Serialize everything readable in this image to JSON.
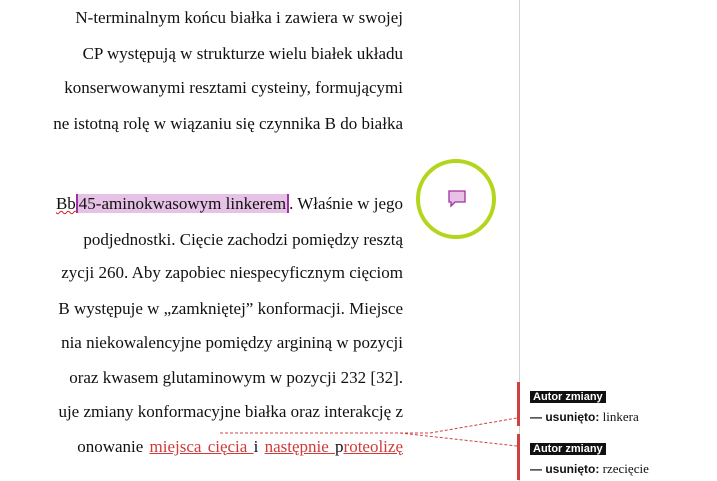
{
  "document": {
    "lines": [
      {
        "text": "N-terminalnym końcu białka i zawiera w swojej"
      },
      {
        "text": "CP występują w strukturze wielu białek układu"
      },
      {
        "text": "konserwowanymi resztami cysteiny, formującymi"
      },
      {
        "text": "ne istotną rolę w wiązaniu się czynnika B do białka"
      },
      {
        "pre": "Bb",
        "highlight": "45-aminokwasowym linkerem",
        "post": ". Właśnie w jego"
      },
      {
        "text": "podjednostki. Cięcie zachodzi pomiędzy resztą"
      },
      {
        "text": "zycji 260. Aby zapobiec niespecyficznym cięciom"
      },
      {
        "text": "B występuje w „zamkniętej” konformacji. Miejsce"
      },
      {
        "text": "nia niekowalencyjne pomiędzy argininą w pozycji"
      },
      {
        "text": "oraz kwasem glutaminowym w pozycji 232 [32]."
      },
      {
        "text": "uje zmiany konformacyjne białka oraz interakcję z"
      },
      {
        "pre": "onowanie ",
        "ins1": "miejsca cięcia ",
        "mid": "i ",
        "ins2": "następnie ",
        "mid2": "p",
        "ins3": "roteolizę"
      }
    ]
  },
  "comments": [
    {
      "author": "Autor zmiany",
      "label": "— usunięto:",
      "text": "linkera"
    },
    {
      "author": "Autor zmiany",
      "label": "— usunięto:",
      "text": "rzecięcie"
    }
  ],
  "colors": {
    "highlight": "#e6c2e6",
    "insert": "#d03a3a",
    "circle": "#b2d61c",
    "comment_icon": "#a030a0"
  },
  "icons": {
    "comment": "comment-bubble-icon"
  }
}
